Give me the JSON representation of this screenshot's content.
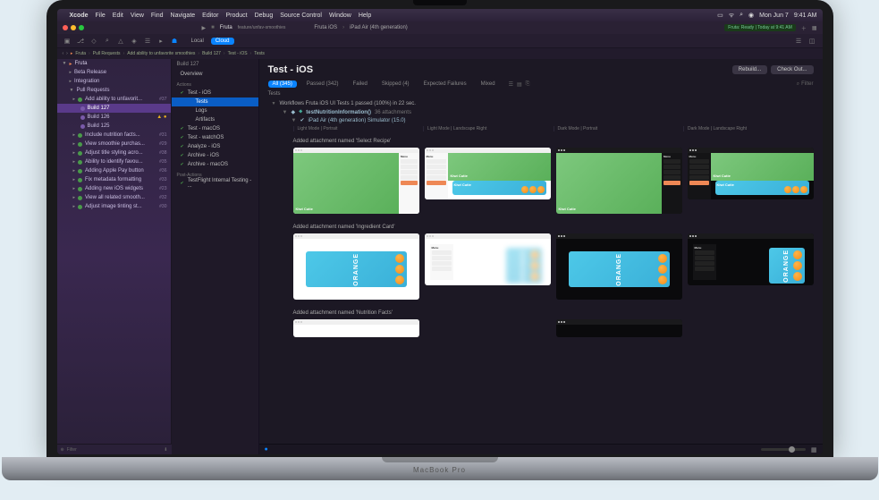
{
  "menubar": {
    "apple": "",
    "items": [
      "Xcode",
      "File",
      "Edit",
      "View",
      "Find",
      "Navigate",
      "Editor",
      "Product",
      "Debug",
      "Source Control",
      "Window",
      "Help"
    ],
    "right": {
      "date": "Mon Jun 7",
      "time": "9:41 AM"
    }
  },
  "titlebar": {
    "project": "Fruta",
    "branch": "feature/unfav-smoothies",
    "scheme": "Fruta iOS",
    "device": "iPad Air (4th generation)",
    "status": "Fruta: Ready | Today at 9:41 AM"
  },
  "toolbar": {
    "local": "Local",
    "cloud": "Cloud"
  },
  "crumbs": [
    "Fruta",
    "Pull Requests",
    "Add ability to unfavorite smoothies",
    "Build 127",
    "Test - iOS",
    "Tests"
  ],
  "nav": {
    "root": "Fruta",
    "items": [
      {
        "t": "Beta Release",
        "l": 1
      },
      {
        "t": "Integration",
        "l": 1
      },
      {
        "t": "Pull Requests",
        "l": 1,
        "open": true
      },
      {
        "t": "Add ability to unfavorit...",
        "l": 2,
        "n": "#37",
        "sel": false,
        "dot": "gr"
      },
      {
        "t": "Build 127",
        "l": 3,
        "sel": true
      },
      {
        "t": "Build 126",
        "l": 3,
        "warn": true
      },
      {
        "t": "Build 125",
        "l": 3
      },
      {
        "t": "Include nutrition facts...",
        "l": 2,
        "n": "#31",
        "dot": "gr"
      },
      {
        "t": "View smoothie purchas...",
        "l": 2,
        "n": "#29",
        "dot": "gr"
      },
      {
        "t": "Adjust title styling acro...",
        "l": 2,
        "n": "#38",
        "dot": "gr"
      },
      {
        "t": "Ability to identify favou...",
        "l": 2,
        "n": "#35",
        "dot": "gr"
      },
      {
        "t": "Adding Apple Pay button",
        "l": 2,
        "n": "#36",
        "dot": "gr"
      },
      {
        "t": "Fix metadata formatting",
        "l": 2,
        "n": "#33",
        "dot": "gr"
      },
      {
        "t": "Adding new iOS widgets",
        "l": 2,
        "n": "#23",
        "dot": "gr"
      },
      {
        "t": "View all related smooth...",
        "l": 2,
        "n": "#32",
        "dot": "gr"
      },
      {
        "t": "Adjust image tinting st...",
        "l": 2,
        "n": "#30",
        "dot": "gr"
      }
    ],
    "filter": "Filter"
  },
  "middle": {
    "build": "Build 127",
    "overview": "Overview",
    "actions_label": "Actions",
    "actions": [
      {
        "t": "Test - iOS",
        "open": true,
        "ok": true
      },
      {
        "t": "Tests",
        "l": 2,
        "sel": true
      },
      {
        "t": "Logs",
        "l": 2
      },
      {
        "t": "Artifacts",
        "l": 2
      },
      {
        "t": "Test - macOS",
        "ok": true
      },
      {
        "t": "Test - watchOS",
        "ok": true
      },
      {
        "t": "Analyze - iOS",
        "ok": true
      },
      {
        "t": "Archive - iOS",
        "ok": true
      },
      {
        "t": "Archive - macOS",
        "ok": true
      }
    ],
    "post_label": "Post-Actions",
    "post": [
      {
        "t": "TestFlight Internal Testing - ...",
        "ok": true
      }
    ]
  },
  "content": {
    "title": "Test - iOS",
    "buttons": {
      "rebuild": "Rebuild...",
      "checkout": "Check Out..."
    },
    "filters": {
      "all": "All (345)",
      "passed": "Passed (342)",
      "failed": "Failed",
      "skipped": "Skipped (4)",
      "expected": "Expected Failures",
      "mixed": "Mixed",
      "search": "Filter"
    },
    "sub": "Tests",
    "workflow": "Workflows  Fruta iOS UI Tests   1 passed (100%) in 22 sec.",
    "test": {
      "name": "testNutritionInformation()",
      "attcount": "36 attachments"
    },
    "device": "iPad Air (4th generation) Simulator (15.0)",
    "cols": [
      "Light Mode | Portrait",
      "Light Mode | Landscape Right",
      "Dark Mode | Portrait",
      "Dark Mode | Landscape Right"
    ],
    "sections": [
      "Added attachment named 'Select Recipe'",
      "Added attachment named 'Ingredient Card'",
      "Added attachment named 'Nutrition Facts'"
    ],
    "recipe": "Kiwi Cutie",
    "menu": "Menu",
    "orange": "ORANGE"
  },
  "laptop": "MacBook Pro"
}
